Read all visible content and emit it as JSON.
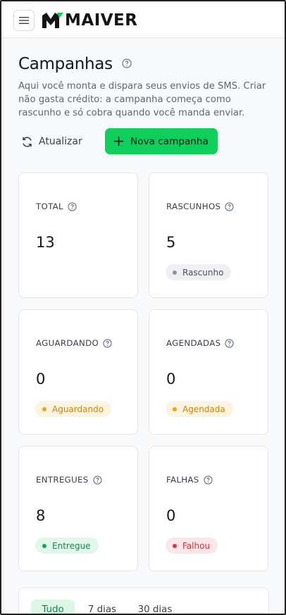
{
  "app": {
    "brand": "MAIVER"
  },
  "header": {
    "title": "Campanhas",
    "description": "Aqui você monta e dispara seus envios de SMS. Criar não gasta crédito: a campanha começa como rascunho e só cobra quando você manda enviar."
  },
  "actions": {
    "refresh_label": "Atualizar",
    "new_campaign_label": "Nova campanha"
  },
  "stats": [
    {
      "label": "TOTAL",
      "value": "13",
      "badge": null
    },
    {
      "label": "RASCUNHOS",
      "value": "5",
      "badge": "Rascunho",
      "badge_color": "#8c939d"
    },
    {
      "label": "AGUARDANDO",
      "value": "0",
      "badge": "Aguardando",
      "badge_color": "#e8a21c"
    },
    {
      "label": "AGENDADAS",
      "value": "0",
      "badge": "Agendada",
      "badge_color": "#e8a21c"
    },
    {
      "label": "ENTREGUES",
      "value": "8",
      "badge": "Entregue",
      "badge_color": "#18a558"
    },
    {
      "label": "FALHAS",
      "value": "0",
      "badge": "Falhou",
      "badge_color": "#dc3545"
    }
  ],
  "filters": {
    "tabs": [
      "Tudo",
      "7 dias",
      "30 dias"
    ],
    "active": "Tudo"
  },
  "colors": {
    "accent": "#0fce5c",
    "accent_text": "#0c1f13",
    "background": "#f8f9fa"
  },
  "icons": {
    "menu": "hamburger-menu-icon",
    "help": "question-circle-icon",
    "refresh": "refresh-icon",
    "add": "plus-icon"
  }
}
